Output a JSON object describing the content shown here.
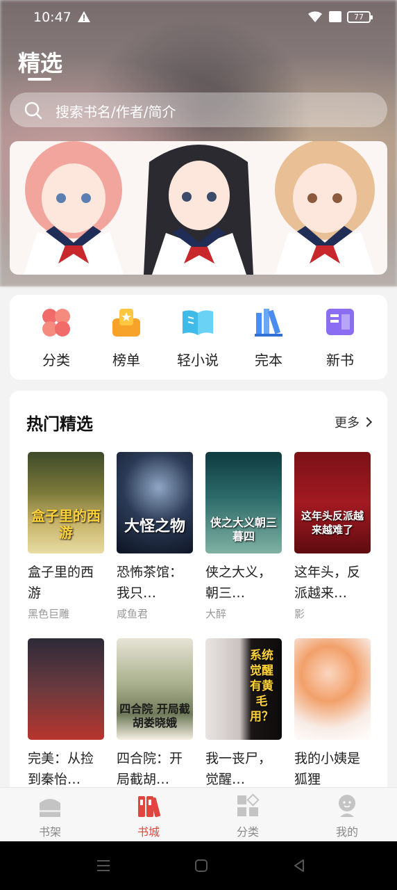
{
  "status_bar": {
    "time": "10:47",
    "battery": "77"
  },
  "header": {
    "title": "精选"
  },
  "search": {
    "placeholder": "搜索书名/作者/简介"
  },
  "categories": [
    {
      "label": "分类",
      "icon": "clover-icon"
    },
    {
      "label": "榜单",
      "icon": "ranking-icon"
    },
    {
      "label": "轻小说",
      "icon": "open-book-icon"
    },
    {
      "label": "完本",
      "icon": "books-shelf-icon"
    },
    {
      "label": "新书",
      "icon": "new-book-icon"
    }
  ],
  "hot": {
    "title": "热门精选",
    "more": "更多",
    "books": [
      {
        "title": "盒子里的西游",
        "author": "黑色巨雕",
        "cover_text": "盒子里的西游"
      },
      {
        "title": "恐怖茶馆：我只…",
        "author": "咸鱼君",
        "cover_text": "大怪之物"
      },
      {
        "title": "侠之大义，朝三…",
        "author": "大醉",
        "cover_text": "侠之大义朝三暮四"
      },
      {
        "title": "这年头，反派越来…",
        "author": "影",
        "cover_text": "这年头反派越来越难了"
      },
      {
        "title": "完美：从捡到秦怡…",
        "author": "",
        "cover_text": ""
      },
      {
        "title": "四合院：开局截胡…",
        "author": "",
        "cover_text": "四合院 开局截胡娄晓娥"
      },
      {
        "title": "我一丧尸，觉醒…",
        "author": "",
        "cover_text": "系统觉醒有黄毛用？"
      },
      {
        "title": "我的小姨是狐狸",
        "author": "",
        "cover_text": ""
      }
    ]
  },
  "bottom_nav": [
    {
      "label": "书架",
      "active": false
    },
    {
      "label": "书城",
      "active": true
    },
    {
      "label": "分类",
      "active": false
    },
    {
      "label": "我的",
      "active": false
    }
  ],
  "colors": {
    "accent": "#e0463f",
    "background": "#f3f3f3"
  }
}
